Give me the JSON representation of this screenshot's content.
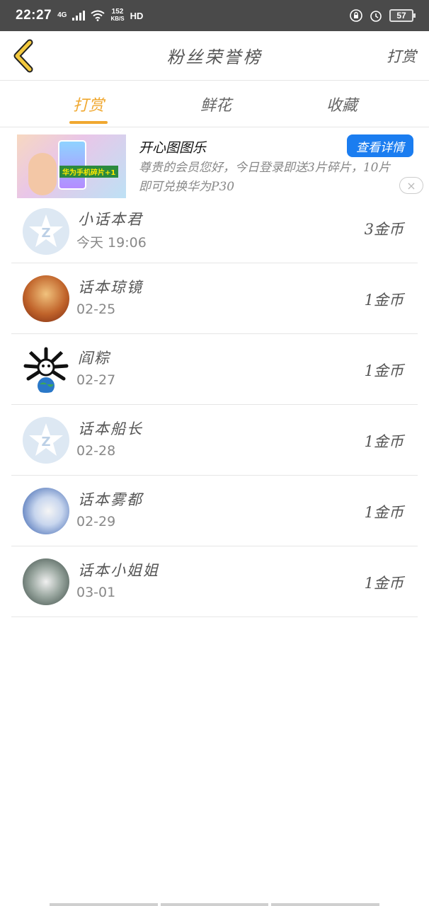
{
  "status_bar": {
    "time": "22:27",
    "network": "4G",
    "speed_value": "152",
    "speed_unit": "KB/S",
    "hd": "HD",
    "battery": "57"
  },
  "header": {
    "title": "粉丝荣誉榜",
    "action_label": "打赏"
  },
  "tabs": [
    {
      "label": "打赏",
      "active": true
    },
    {
      "label": "鲜花",
      "active": false
    },
    {
      "label": "收藏",
      "active": false
    }
  ],
  "ad": {
    "thumb_caption": "华为手机碎片+1",
    "title": "开心图图乐",
    "description": "尊贵的会员您好，今日登录即送3片碎片，10片即可兑换华为P30",
    "button_label": "查看详情",
    "close_symbol": "×"
  },
  "list": [
    {
      "name": "小话本君",
      "date": "今天 19:06",
      "coins": "3金币",
      "avatar": "default-avatar-icon"
    },
    {
      "name": "话本琼镜",
      "date": "02-25",
      "coins": "1金币",
      "avatar": "photo-avatar"
    },
    {
      "name": "阎粽",
      "date": "02-27",
      "coins": "1金币",
      "avatar": "cartoon-avatar"
    },
    {
      "name": "话本船长",
      "date": "02-28",
      "coins": "1金币",
      "avatar": "default-avatar-icon"
    },
    {
      "name": "话本雾都",
      "date": "02-29",
      "coins": "1金币",
      "avatar": "photo-avatar"
    },
    {
      "name": "话本小姐姐",
      "date": "03-01",
      "coins": "1金币",
      "avatar": "photo-avatar"
    }
  ],
  "colors": {
    "accent": "#f0a830",
    "ad_button": "#1b7df0",
    "status_bar": "#4a4a4a"
  }
}
